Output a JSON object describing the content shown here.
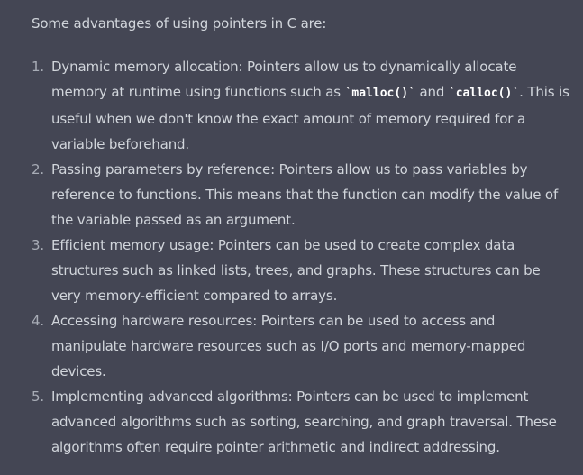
{
  "message": {
    "intro": "Some advantages of using pointers in C are:",
    "items": [
      {
        "number": "1.",
        "text_before": "Dynamic memory allocation: Pointers allow us to dynamically allocate memory at runtime using functions such as ",
        "code_1": "`malloc()`",
        "text_middle": " and ",
        "code_2": "`calloc()`",
        "text_after": ". This is useful when we don't know the exact amount of memory required for a variable beforehand."
      },
      {
        "number": "2.",
        "text": "Passing parameters by reference: Pointers allow us to pass variables by reference to functions. This means that the function can modify the value of the variable passed as an argument."
      },
      {
        "number": "3.",
        "text": "Efficient memory usage: Pointers can be used to create complex data structures such as linked lists, trees, and graphs. These structures can be very memory-efficient compared to arrays."
      },
      {
        "number": "4.",
        "text": "Accessing hardware resources: Pointers can be used to access and manipulate hardware resources such as I/O ports and memory-mapped devices."
      },
      {
        "number": "5.",
        "text": "Implementing advanced algorithms: Pointers can be used to implement advanced algorithms such as sorting, searching, and graph traversal. These algorithms often require pointer arithmetic and indirect addressing."
      }
    ]
  },
  "colors": {
    "background": "#444654",
    "text": "#d1d5db",
    "code": "#ffffff",
    "list_number": "#a8acb6"
  }
}
